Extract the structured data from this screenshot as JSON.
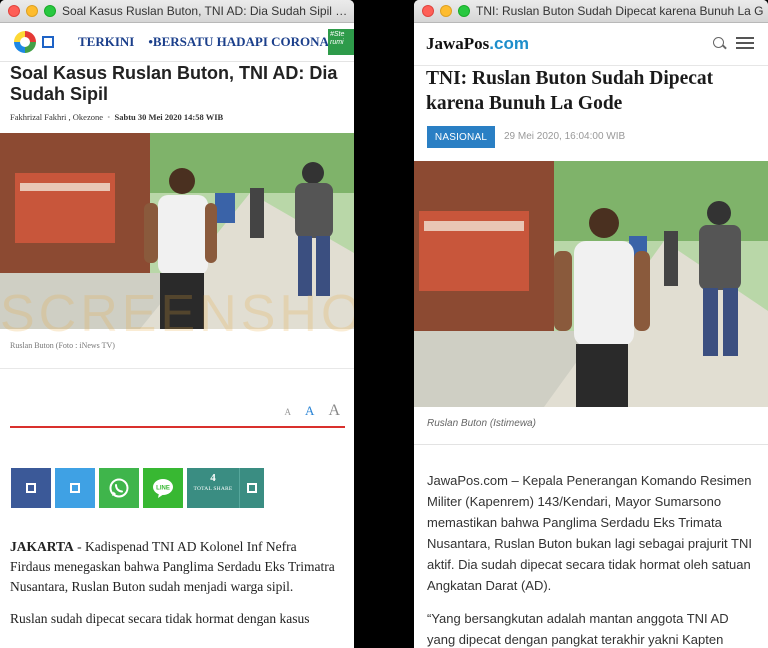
{
  "left": {
    "window_title": "Soal Kasus Ruslan Buton, TNI AD: Dia Sudah Sipil : Okezone",
    "nav": {
      "terkini": "TERKINI",
      "corona": "•BERSATU HADAPI CORONA",
      "covid_badge": "#Ste rumi"
    },
    "headline": "Soal Kasus Ruslan Buton, TNI AD: Dia Sudah Sipil",
    "author": "Fakhrizal Fakhri , Okezone",
    "date_sep": "•",
    "date": "Sabtu 30 Mei 2020 14:58 WIB",
    "watermark": "SCREENSHOT BY",
    "caption": "Ruslan Buton (Foto : iNews TV)",
    "font_sizes": [
      "A",
      "A",
      "A"
    ],
    "share": {
      "count": "4",
      "label": "TOTAL SHARE"
    },
    "body_lead": "JAKARTA",
    "body_p1": " - Kadispenad TNI AD Kolonel Inf Nefra Firdaus menegaskan bahwa Panglima Serdadu Eks Trimatra Nusantara, Ruslan Buton sudah menjadi warga sipil.",
    "body_p2": "Ruslan sudah dipecat secara tidak hormat dengan kasus"
  },
  "right": {
    "window_title": "TNI: Ruslan Buton Sudah Dipecat karena Bunuh La Gode",
    "logo_main": "JawaPos",
    "logo_suffix": ".com",
    "headline": "TNI: Ruslan Buton Sudah Dipecat karena Bunuh La Gode",
    "tag": "NASIONAL",
    "date": "29 Mei 2020, 16:04:00 WIB",
    "caption": "Ruslan Buton (Istimewa)",
    "body_p1": "JawaPos.com – Kepala Penerangan Komando Resimen Militer (Kapenrem) 143/Kendari, Mayor Sumarsono memastikan bahwa Panglima Serdadu Eks Trimata Nusantara, Ruslan Buton bukan lagi sebagai prajurit TNI aktif. Dia sudah dipecat secara tidak hormat oleh satuan Angkatan Darat (AD).",
    "body_p2": "“Yang bersangkutan adalah mantan anggota TNI AD yang dipecat dengan pangkat terakhir yakni Kapten"
  },
  "colors": {
    "okezone_red_line": "#d9302d",
    "facebook": "#3b5998",
    "twitter": "#3fa1e4",
    "whatsapp": "#3fb54b",
    "line": "#38b832",
    "total_share": "#3a8d82",
    "jawapos_tag": "#2a7fc4"
  }
}
